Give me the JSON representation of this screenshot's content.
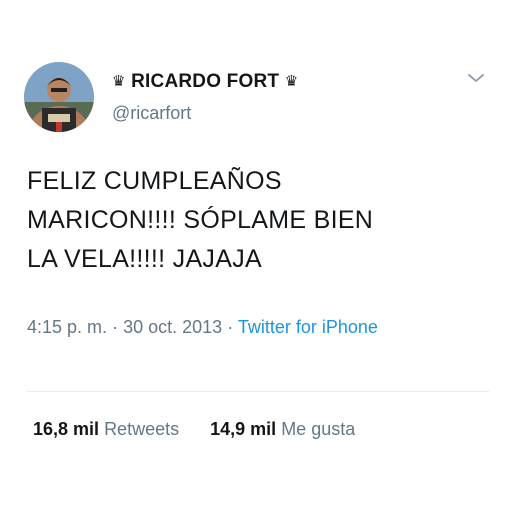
{
  "user": {
    "display_name": "RICARDO FORT",
    "crown_glyph": "♛",
    "handle": "@ricarfort",
    "avatar_icon": "profile-photo"
  },
  "tweet": {
    "text": "FELIZ CUMPLEAÑOS\nMARICON!!!! SÓPLAME BIEN\nLA VELA!!!!! JAJAJA",
    "time": "4:15 p. m.",
    "separator": "·",
    "date": "30 oct. 2013",
    "source": "Twitter for iPhone"
  },
  "stats": {
    "retweets_count": "16,8 mil",
    "retweets_label": "Retweets",
    "likes_count": "14,9 mil",
    "likes_label": "Me gusta"
  },
  "colors": {
    "text": "#14171a",
    "secondary": "#657786",
    "link": "#1b95e0",
    "divider": "#e6ecf0"
  },
  "icons": {
    "menu": "chevron-down-icon"
  }
}
